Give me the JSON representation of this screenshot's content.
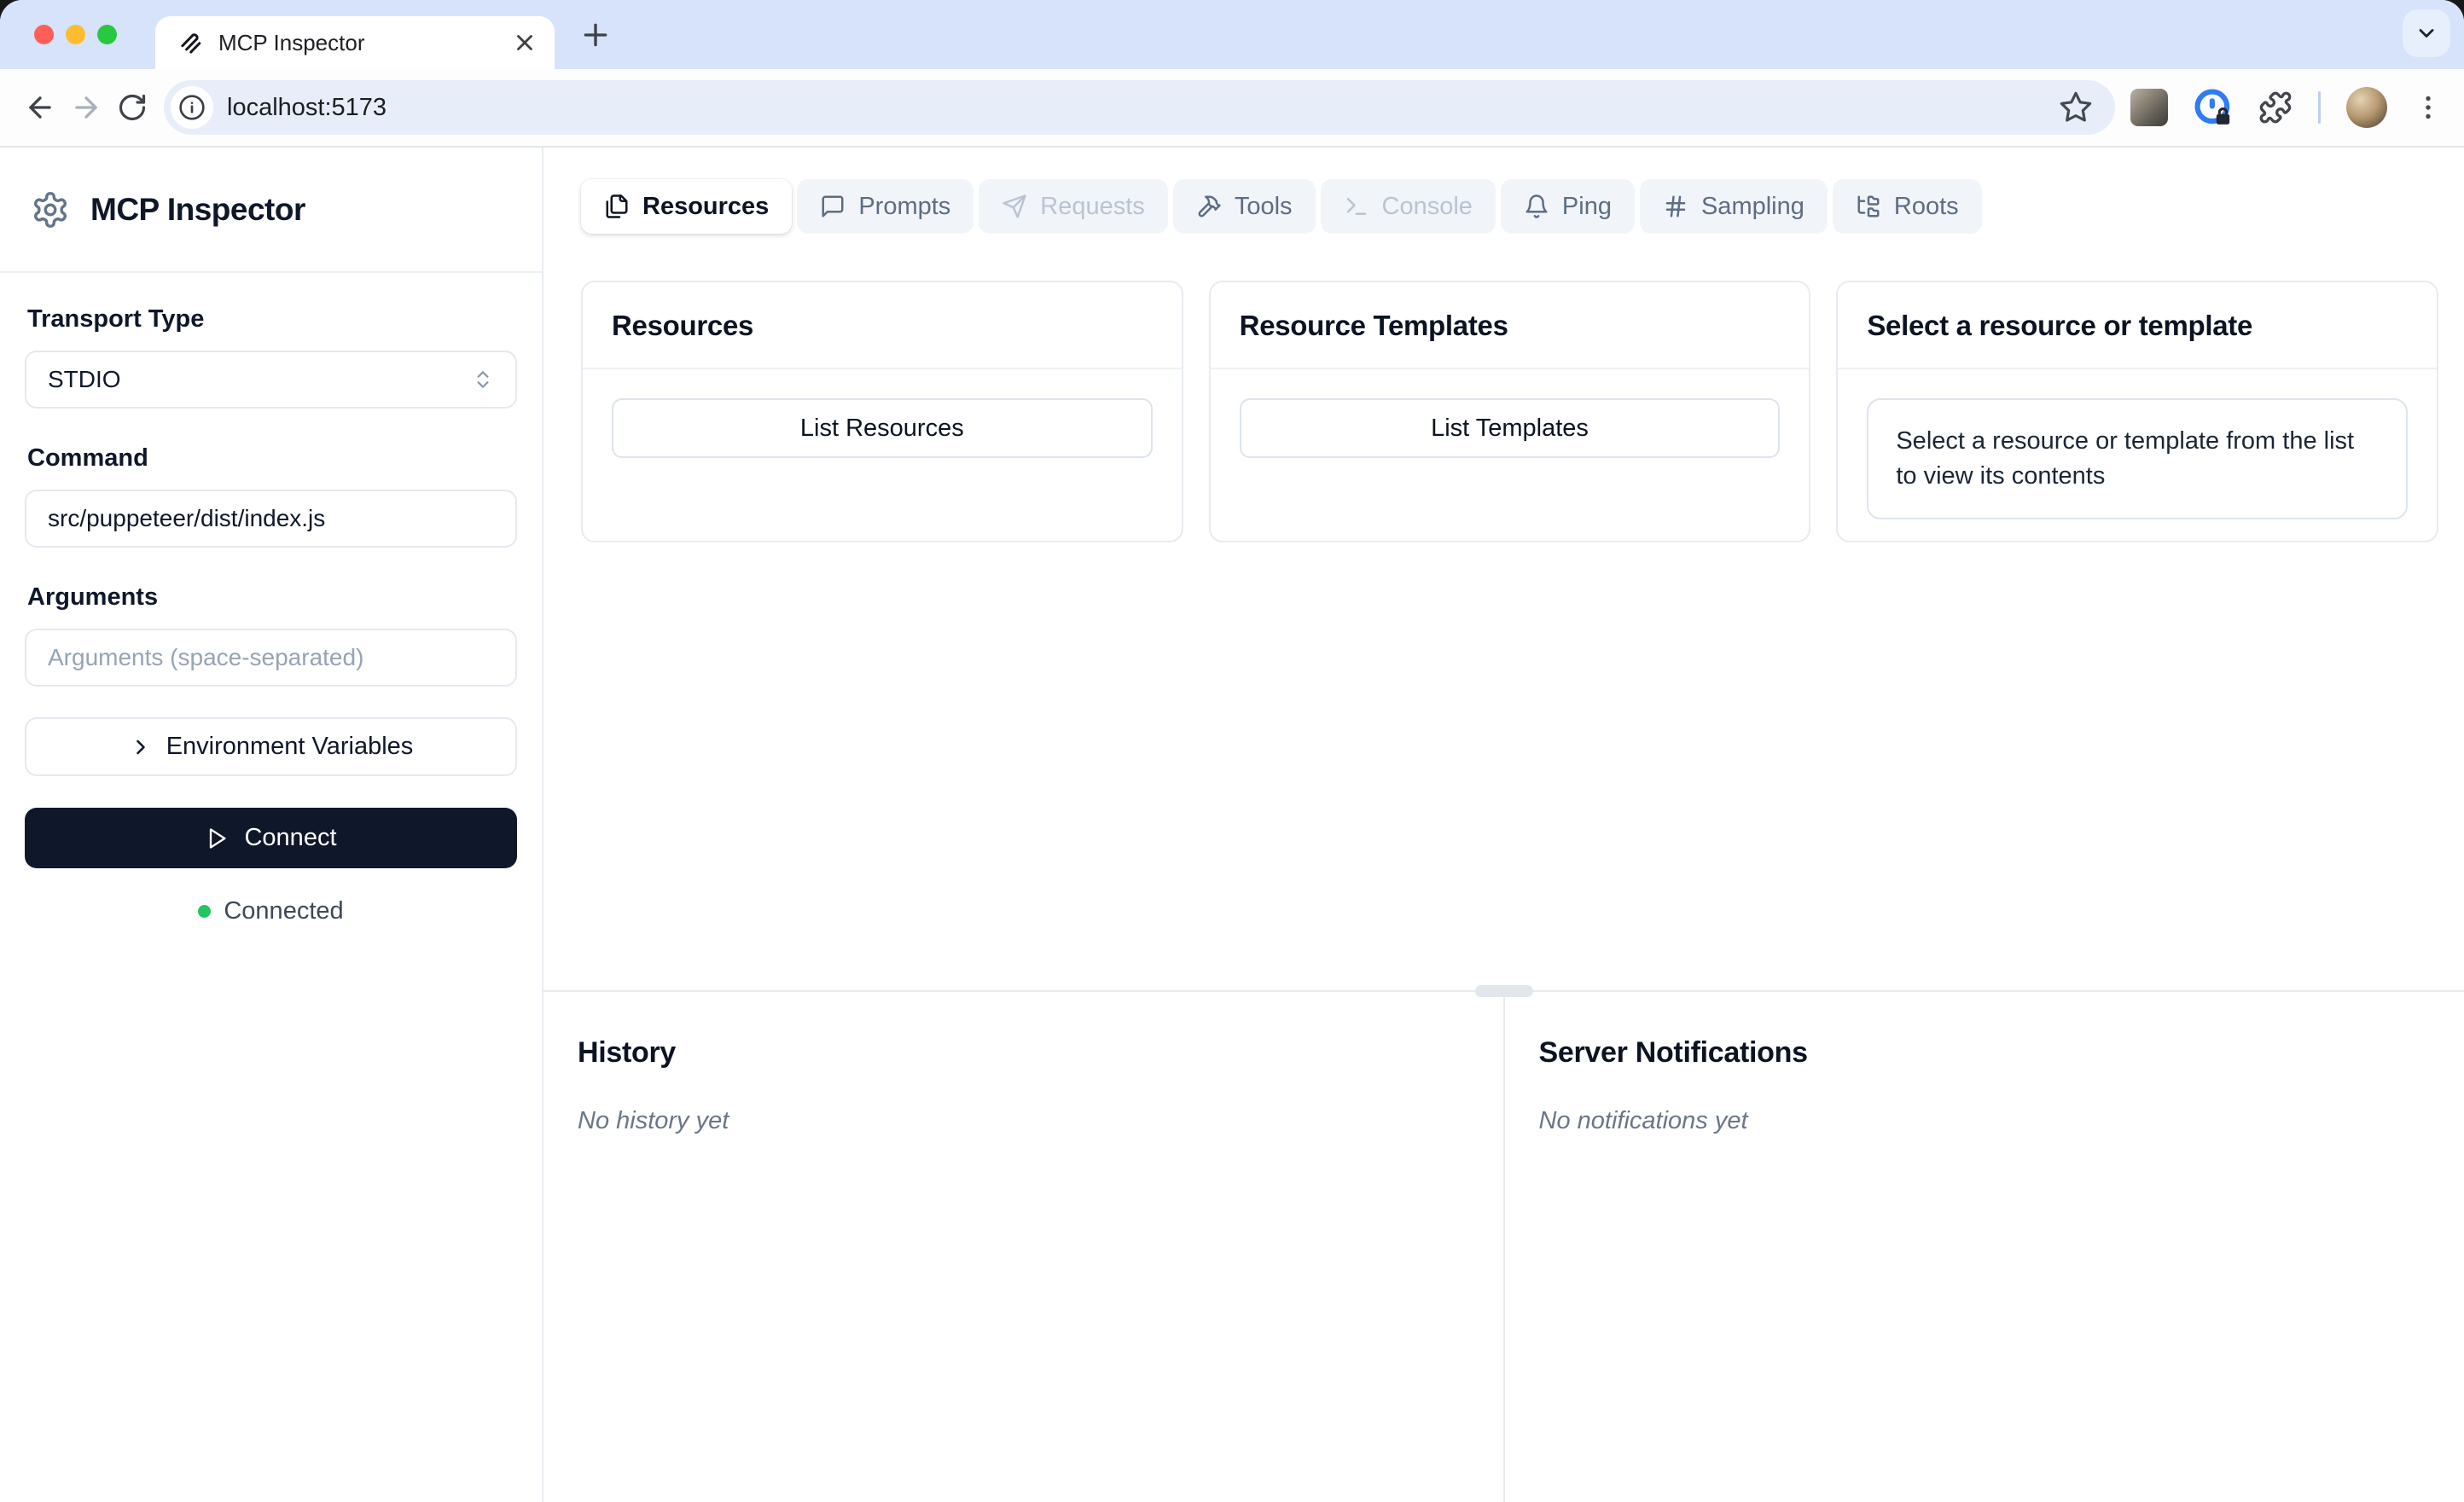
{
  "browser": {
    "tab_title": "MCP Inspector",
    "url": "localhost:5173"
  },
  "sidebar": {
    "app_title": "MCP Inspector",
    "transport_label": "Transport Type",
    "transport_value": "STDIO",
    "command_label": "Command",
    "command_value": "src/puppeteer/dist/index.js",
    "arguments_label": "Arguments",
    "arguments_placeholder": "Arguments (space-separated)",
    "env_button_label": "Environment Variables",
    "connect_button_label": "Connect",
    "status_text": "Connected"
  },
  "tabs": [
    {
      "label": "Resources",
      "icon": "files-icon",
      "state": "active"
    },
    {
      "label": "Prompts",
      "icon": "message-icon",
      "state": "enabled"
    },
    {
      "label": "Requests",
      "icon": "send-icon",
      "state": "disabled"
    },
    {
      "label": "Tools",
      "icon": "hammer-icon",
      "state": "enabled"
    },
    {
      "label": "Console",
      "icon": "terminal-icon",
      "state": "disabled"
    },
    {
      "label": "Ping",
      "icon": "bell-icon",
      "state": "enabled"
    },
    {
      "label": "Sampling",
      "icon": "hash-icon",
      "state": "enabled"
    },
    {
      "label": "Roots",
      "icon": "folder-tree-icon",
      "state": "enabled"
    }
  ],
  "panels": {
    "resources": {
      "title": "Resources",
      "button_label": "List Resources"
    },
    "templates": {
      "title": "Resource Templates",
      "button_label": "List Templates"
    },
    "detail": {
      "title": "Select a resource or template",
      "message": "Select a resource or template from the list to view its contents"
    }
  },
  "history": {
    "title": "History",
    "empty_text": "No history yet"
  },
  "notifications": {
    "title": "Server Notifications",
    "empty_text": "No notifications yet"
  },
  "colors": {
    "connected_dot": "#22c55e",
    "connect_button_bg": "#0f172a",
    "chrome_tab_strip": "#d6e3fb",
    "omnibox_bg": "#e8eef9",
    "muted_tab_bg": "#f1f5f9",
    "border": "#e7ebf1"
  }
}
